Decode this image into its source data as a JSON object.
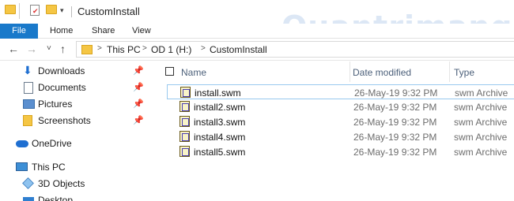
{
  "window": {
    "title": "CustomInstall"
  },
  "ribbon": {
    "tabs": [
      "File",
      "Home",
      "Share",
      "View"
    ]
  },
  "address": {
    "crumbs": [
      "This PC",
      "OD 1 (H:)",
      "CustomInstall"
    ],
    "separator": ">"
  },
  "nav_buttons": {
    "back": "←",
    "forward": "→",
    "recent": "˅",
    "up": "↑"
  },
  "sidebar": {
    "items": [
      {
        "label": "Downloads",
        "icon": "download-arrow-icon",
        "pinned": true
      },
      {
        "label": "Documents",
        "icon": "documents-icon",
        "pinned": true
      },
      {
        "label": "Pictures",
        "icon": "pictures-icon",
        "pinned": true
      },
      {
        "label": "Screenshots",
        "icon": "folder-icon",
        "pinned": true
      },
      {
        "label": "OneDrive",
        "icon": "cloud-icon",
        "pinned": false
      },
      {
        "label": "This PC",
        "icon": "computer-icon",
        "pinned": false
      },
      {
        "label": "3D Objects",
        "icon": "3d-objects-icon",
        "pinned": false
      },
      {
        "label": "Desktop",
        "icon": "desktop-icon",
        "pinned": false
      }
    ]
  },
  "table": {
    "columns": [
      "Name",
      "Date modified",
      "Type"
    ],
    "rows": [
      {
        "name": "install.swm",
        "date": "26-May-19 9:32 PM",
        "type": "swm Archive"
      },
      {
        "name": "install2.swm",
        "date": "26-May-19 9:32 PM",
        "type": "swm Archive"
      },
      {
        "name": "install3.swm",
        "date": "26-May-19 9:32 PM",
        "type": "swm Archive"
      },
      {
        "name": "install4.swm",
        "date": "26-May-19 9:32 PM",
        "type": "swm Archive"
      },
      {
        "name": "install5.swm",
        "date": "26-May-19 9:32 PM",
        "type": "swm Archive"
      }
    ]
  },
  "watermark": "Quantrimang",
  "colors": {
    "accent": "#1979ca",
    "selection_border": "#99c9ef",
    "header_text": "#4c607a"
  }
}
